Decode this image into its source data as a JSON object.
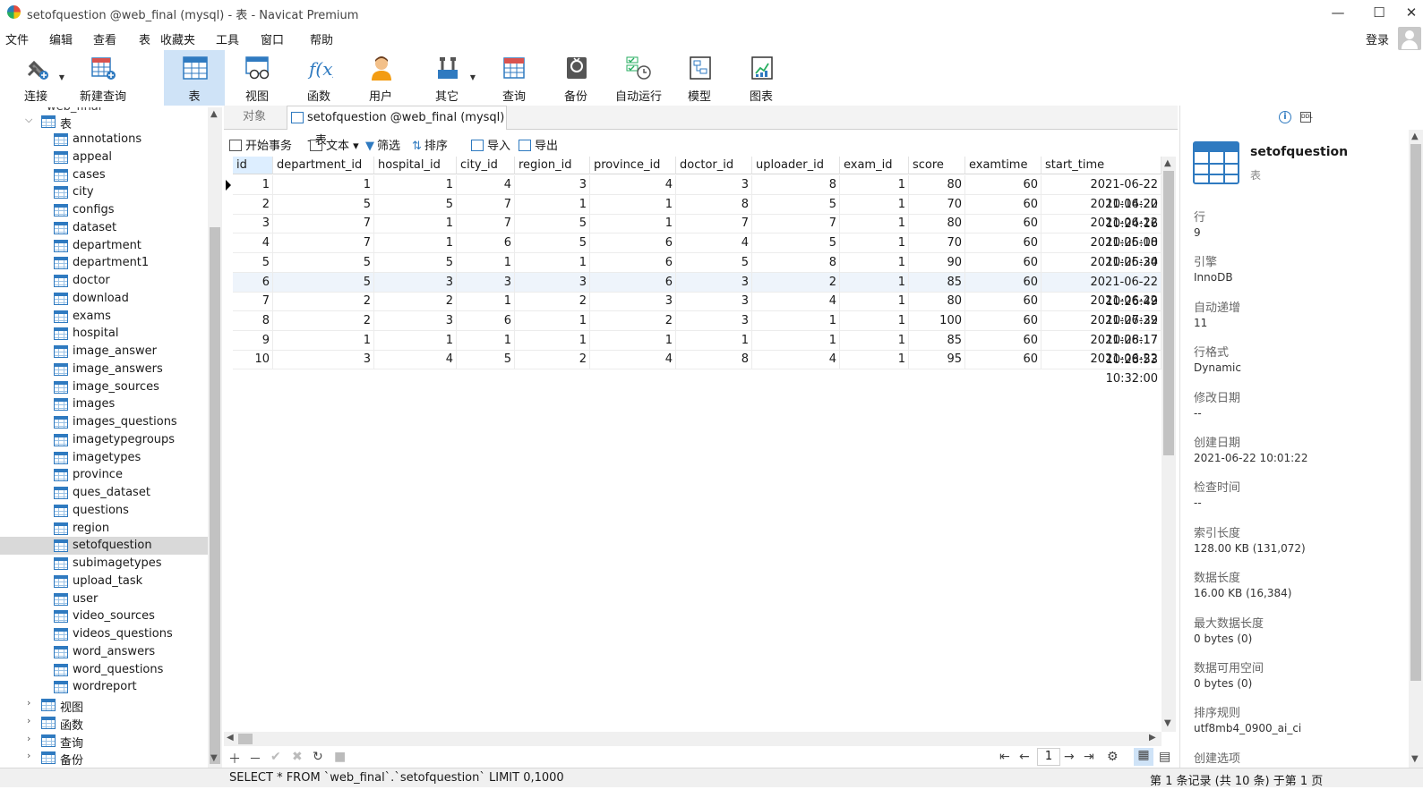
{
  "window": {
    "title": "setofquestion @web_final (mysql) - 表 - Navicat Premium",
    "minimize": "—",
    "maximize": "☐",
    "close": "✕"
  },
  "menu": [
    "文件",
    "编辑",
    "查看",
    "表",
    "收藏夹",
    "工具",
    "窗口",
    "帮助"
  ],
  "login_label": "登录",
  "toolbar": [
    {
      "label": "连接",
      "icon": "plug-icon"
    },
    {
      "label": "新建查询",
      "icon": "new-query-icon"
    },
    {
      "label": "表",
      "icon": "table-icon"
    },
    {
      "label": "视图",
      "icon": "view-icon"
    },
    {
      "label": "函数",
      "icon": "function-icon"
    },
    {
      "label": "用户",
      "icon": "user-icon"
    },
    {
      "label": "其它",
      "icon": "tools-icon"
    },
    {
      "label": "查询",
      "icon": "query-icon"
    },
    {
      "label": "备份",
      "icon": "backup-icon"
    },
    {
      "label": "自动运行",
      "icon": "schedule-icon"
    },
    {
      "label": "模型",
      "icon": "model-icon"
    },
    {
      "label": "图表",
      "icon": "chart-icon"
    }
  ],
  "tree": {
    "db_partial": "web_final",
    "tables_group": "表",
    "tables": [
      "annotations",
      "appeal",
      "cases",
      "city",
      "configs",
      "dataset",
      "department",
      "department1",
      "doctor",
      "download",
      "exams",
      "hospital",
      "image_answer",
      "image_answers",
      "image_sources",
      "images",
      "images_questions",
      "imagetypegroups",
      "imagetypes",
      "province",
      "ques_dataset",
      "questions",
      "region",
      "setofquestion",
      "subimagetypes",
      "upload_task",
      "user",
      "video_sources",
      "videos_questions",
      "word_answers",
      "word_questions",
      "wordreport"
    ],
    "selected": "setofquestion",
    "groups": [
      "视图",
      "函数",
      "查询",
      "备份"
    ]
  },
  "tabs": {
    "objects": "对象",
    "active": "setofquestion @web_final (mysql) - 表"
  },
  "subtoolbar": [
    "开始事务",
    "文本",
    "筛选",
    "排序",
    "导入",
    "导出"
  ],
  "grid": {
    "columns": [
      "id",
      "department_id",
      "hospital_id",
      "city_id",
      "region_id",
      "province_id",
      "doctor_id",
      "uploader_id",
      "exam_id",
      "score",
      "examtime",
      "start_time"
    ],
    "rows": [
      [
        "1",
        "1",
        "1",
        "4",
        "3",
        "4",
        "3",
        "8",
        "1",
        "80",
        "60",
        "2021-06-22 10:14:20"
      ],
      [
        "2",
        "5",
        "5",
        "7",
        "1",
        "1",
        "8",
        "5",
        "1",
        "70",
        "60",
        "2021-06-22 10:24:16"
      ],
      [
        "3",
        "7",
        "1",
        "7",
        "5",
        "1",
        "7",
        "7",
        "1",
        "80",
        "60",
        "2021-06-22 10:25:00"
      ],
      [
        "4",
        "7",
        "1",
        "6",
        "5",
        "6",
        "4",
        "5",
        "1",
        "70",
        "60",
        "2021-06-18 10:25:34"
      ],
      [
        "5",
        "5",
        "5",
        "1",
        "1",
        "6",
        "5",
        "8",
        "1",
        "90",
        "60",
        "2021-06-20 10:26:13"
      ],
      [
        "6",
        "5",
        "3",
        "3",
        "3",
        "6",
        "3",
        "2",
        "1",
        "85",
        "60",
        "2021-06-22 10:26:49"
      ],
      [
        "7",
        "2",
        "2",
        "1",
        "2",
        "3",
        "3",
        "4",
        "1",
        "80",
        "60",
        "2021-06-22 10:27:39"
      ],
      [
        "8",
        "2",
        "3",
        "6",
        "1",
        "2",
        "3",
        "1",
        "1",
        "100",
        "60",
        "2021-06-22 10:28:17"
      ],
      [
        "9",
        "1",
        "1",
        "1",
        "1",
        "1",
        "1",
        "1",
        "1",
        "85",
        "60",
        "2021-06-17 10:28:53"
      ],
      [
        "10",
        "3",
        "4",
        "5",
        "2",
        "4",
        "8",
        "4",
        "1",
        "95",
        "60",
        "2021-06-22 10:32:00"
      ]
    ]
  },
  "bottom": {
    "page": "1"
  },
  "status": {
    "sql": "SELECT * FROM `web_final`.`setofquestion` LIMIT 0,1000",
    "records": "第 1 条记录 (共 10 条) 于第 1 页"
  },
  "info": {
    "name": "setofquestion",
    "type": "表",
    "props": [
      {
        "label": "行",
        "value": "9"
      },
      {
        "label": "引擎",
        "value": "InnoDB"
      },
      {
        "label": "自动递增",
        "value": "11"
      },
      {
        "label": "行格式",
        "value": "Dynamic"
      },
      {
        "label": "修改日期",
        "value": "--"
      },
      {
        "label": "创建日期",
        "value": "2021-06-22 10:01:22"
      },
      {
        "label": "检查时间",
        "value": "--"
      },
      {
        "label": "索引长度",
        "value": "128.00 KB (131,072)"
      },
      {
        "label": "数据长度",
        "value": "16.00 KB (16,384)"
      },
      {
        "label": "最大数据长度",
        "value": "0 bytes (0)"
      },
      {
        "label": "数据可用空间",
        "value": "0 bytes (0)"
      },
      {
        "label": "排序规则",
        "value": "utf8mb4_0900_ai_ci"
      },
      {
        "label": "创建选项",
        "value": ""
      }
    ]
  },
  "colors": {
    "accent": "#2f7ac0",
    "active_tool_bg": "#cfe3f7",
    "selection_bg": "#d9d9d9"
  }
}
